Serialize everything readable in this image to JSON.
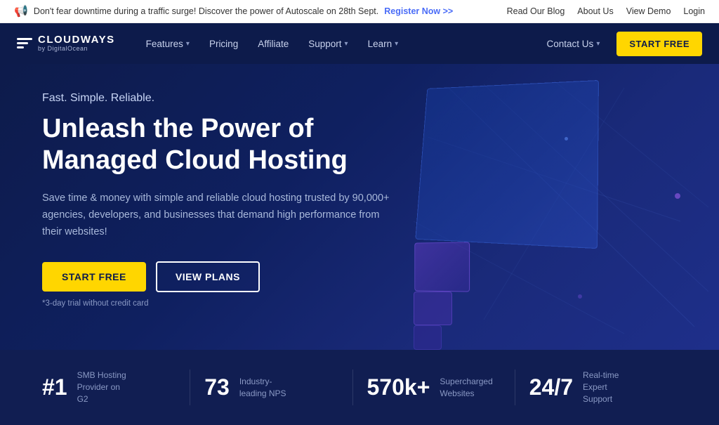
{
  "banner": {
    "message": "Don't fear downtime during a traffic surge! Discover the power of Autoscale on 28th Sept.",
    "cta_text": "Register Now >>",
    "links": [
      "Read Our Blog",
      "About Us",
      "View Demo",
      "Login"
    ]
  },
  "navbar": {
    "logo_main": "CLOUDWAYS",
    "logo_sub": "by DigitalOcean",
    "nav_items": [
      {
        "label": "Features",
        "has_dropdown": true
      },
      {
        "label": "Pricing",
        "has_dropdown": false
      },
      {
        "label": "Affiliate",
        "has_dropdown": false
      },
      {
        "label": "Support",
        "has_dropdown": true
      },
      {
        "label": "Learn",
        "has_dropdown": true
      }
    ],
    "contact_us": "Contact Us",
    "start_free": "START FREE"
  },
  "hero": {
    "tagline": "Fast. Simple. Reliable.",
    "title": "Unleash the Power of Managed Cloud Hosting",
    "description": "Save time & money with simple and reliable cloud hosting trusted by 90,000+ agencies, developers, and businesses that demand high performance from their websites!",
    "btn_start": "START FREE",
    "btn_plans": "VIEW PLANS",
    "note": "*3-day trial without credit card"
  },
  "stats": [
    {
      "number": "#1",
      "desc": "SMB Hosting Provider on G2"
    },
    {
      "number": "73",
      "desc": "Industry-leading NPS"
    },
    {
      "number": "570k+",
      "desc": "Supercharged Websites"
    },
    {
      "number": "24/7",
      "desc": "Real-time Expert Support"
    }
  ]
}
